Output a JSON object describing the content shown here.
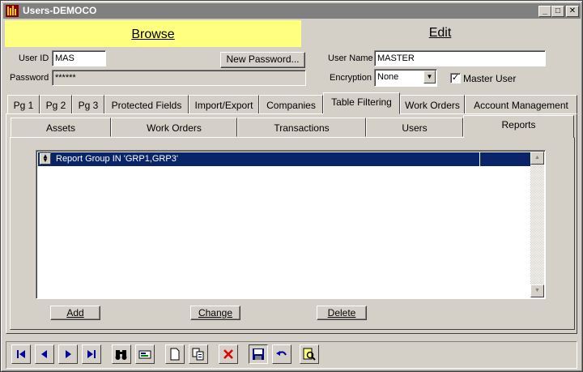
{
  "window": {
    "title": "Users-DEMOCO",
    "minimize_glyph": "_",
    "maximize_glyph": "□",
    "close_glyph": "✕"
  },
  "mode_tabs": {
    "browse": "Browse",
    "edit": "Edit"
  },
  "form": {
    "user_id_label": "User ID",
    "user_id_value": "MAS",
    "password_label": "Password",
    "password_value": "******",
    "new_password_label": "New Password...",
    "user_name_label": "User Name",
    "user_name_value": "MASTER",
    "encryption_label": "Encryption",
    "encryption_value": "None",
    "master_user_label": "Master User",
    "master_user_checked": true,
    "check_glyph": "✓"
  },
  "main_tabs": [
    {
      "label": "Pg 1"
    },
    {
      "label": "Pg 2"
    },
    {
      "label": "Pg 3"
    },
    {
      "label": "Protected Fields"
    },
    {
      "label": "Import/Export"
    },
    {
      "label": "Companies"
    },
    {
      "label": "Table Filtering",
      "active": true
    },
    {
      "label": "Work Orders"
    },
    {
      "label": "Account Management"
    }
  ],
  "sub_tabs": [
    {
      "label": "Assets"
    },
    {
      "label": "Work Orders"
    },
    {
      "label": "Transactions"
    },
    {
      "label": "Users"
    },
    {
      "label": "Reports",
      "active": true
    }
  ],
  "filter_list": {
    "rows": [
      {
        "text": "Report Group IN 'GRP1,GRP3'"
      }
    ]
  },
  "list_buttons": {
    "add": "Add",
    "change": "Change",
    "delete": "Delete"
  },
  "colors": {
    "highlight": "#0a246a",
    "browse_tab": "#ffff80",
    "face": "#d4d0c8"
  },
  "toolbar_icons": [
    "first-record-icon",
    "previous-record-icon",
    "next-record-icon",
    "last-record-icon",
    "find-icon",
    "report-icon",
    "new-record-icon",
    "copy-record-icon",
    "delete-record-icon",
    "save-icon",
    "undo-icon",
    "preview-icon"
  ]
}
